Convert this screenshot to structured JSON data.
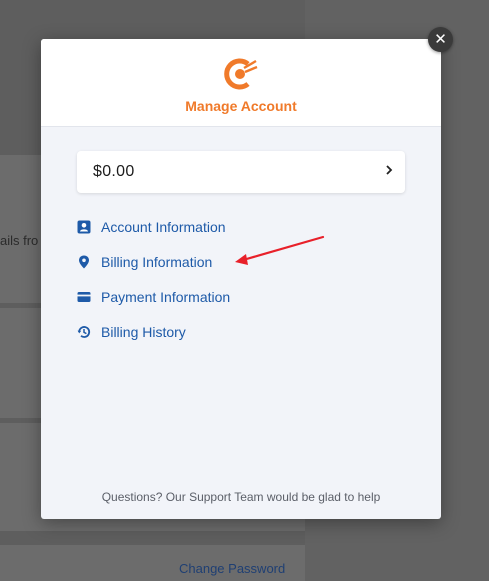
{
  "background": {
    "partial_text": "ails fro",
    "change_password_link": "Change Password"
  },
  "modal": {
    "title": "Manage Account",
    "close_symbol": "✕",
    "balance": {
      "amount": "$0.00"
    },
    "menu": [
      {
        "label": "Account Information",
        "icon": "account-card-icon"
      },
      {
        "label": "Billing Information",
        "icon": "location-pin-icon"
      },
      {
        "label": "Payment Information",
        "icon": "credit-card-icon"
      },
      {
        "label": "Billing History",
        "icon": "history-icon"
      }
    ],
    "footer": "Questions? Our Support Team would be glad to help"
  },
  "colors": {
    "accent": "#f07a2a",
    "link": "#1e5aa8",
    "annotation_arrow": "#e8202a"
  }
}
